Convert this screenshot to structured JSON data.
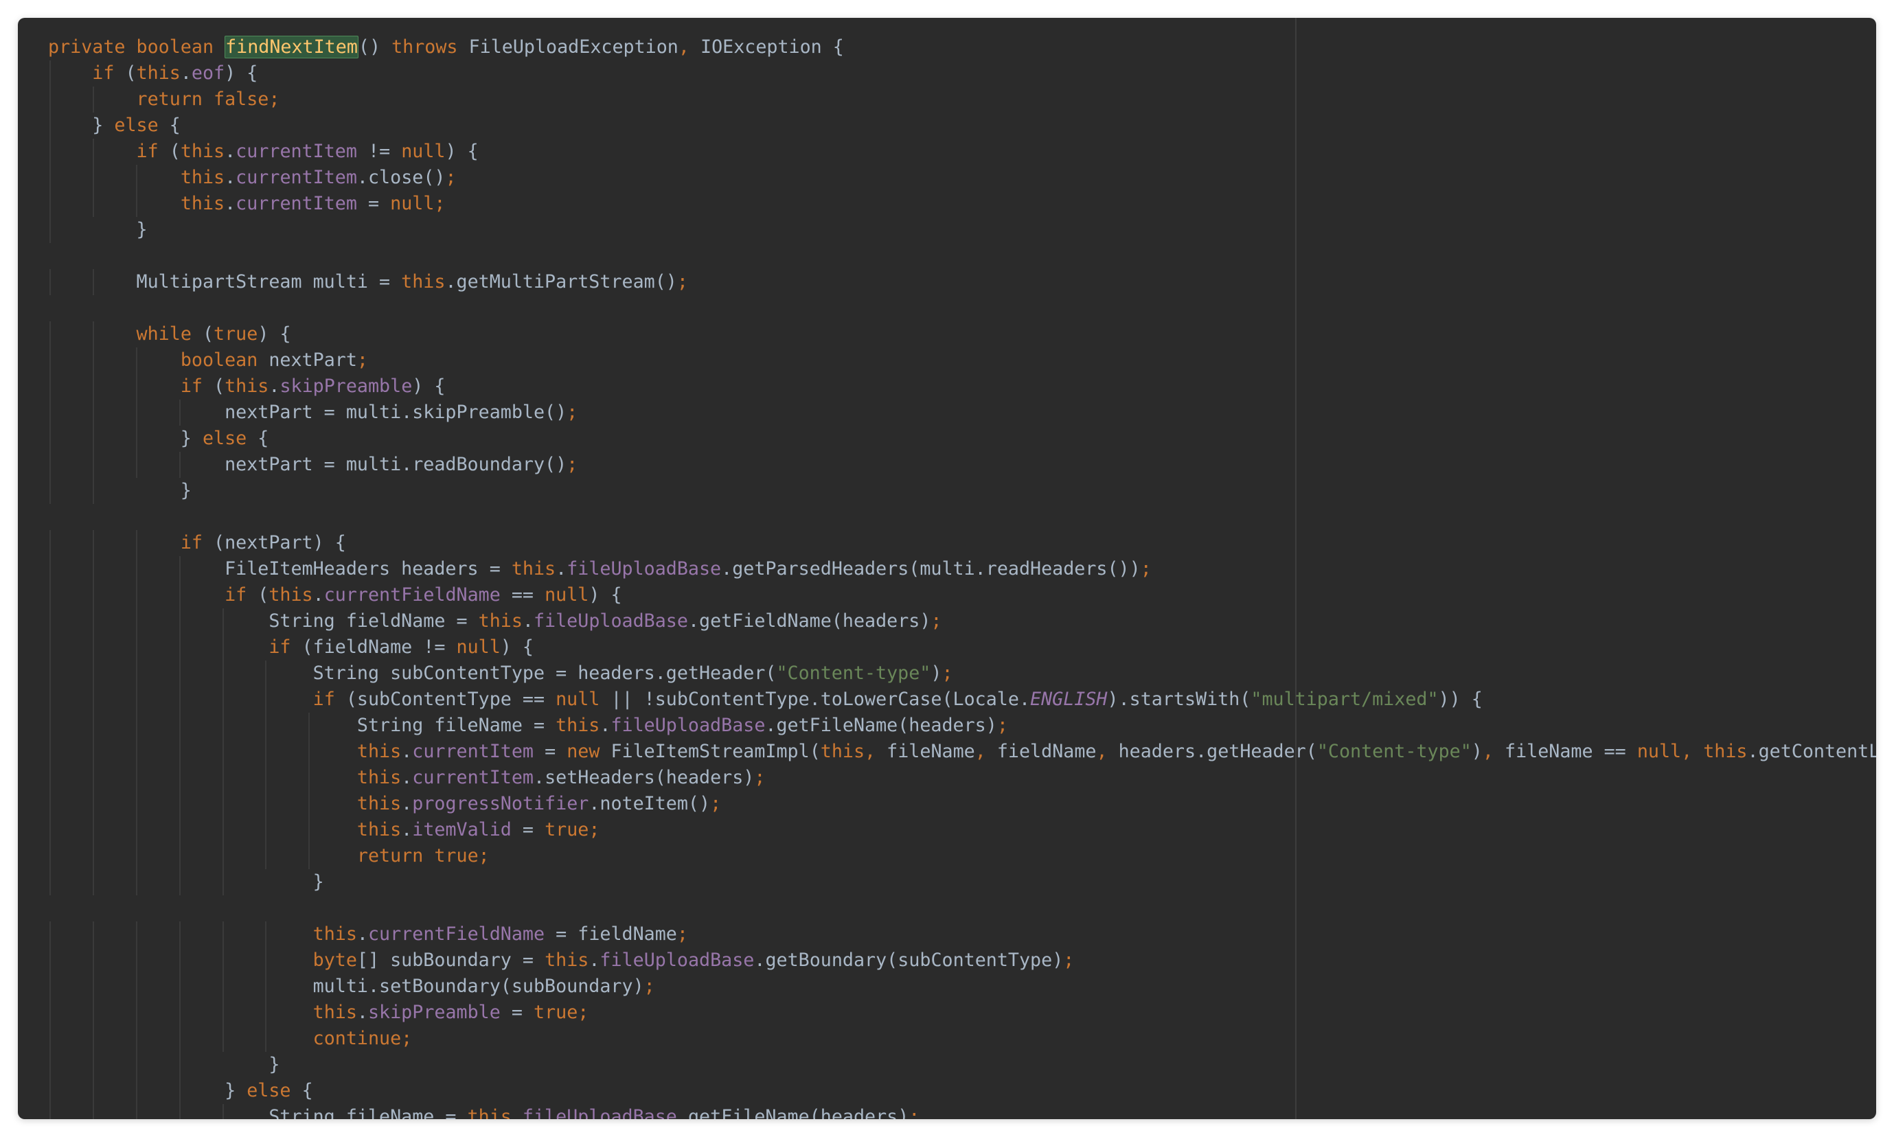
{
  "editor": {
    "theme_colors": {
      "background": "#2b2b2b",
      "keyword": "#cc7832",
      "field": "#9876aa",
      "string": "#6a8759",
      "plain": "#a9b7c6",
      "highlight": "#32593d"
    },
    "lines": [
      [
        [
          "kw",
          "private boolean "
        ],
        [
          "hl",
          "findNextItem"
        ],
        [
          "p",
          "() "
        ],
        [
          "kw",
          "throws "
        ],
        [
          "p",
          "FileUploadException"
        ],
        [
          "kw",
          ", "
        ],
        [
          "p",
          "IOException {"
        ]
      ],
      [
        [
          "p",
          "    "
        ],
        [
          "kw",
          "if "
        ],
        [
          "p",
          "("
        ],
        [
          "kw",
          "this"
        ],
        [
          "p",
          "."
        ],
        [
          "fld",
          "eof"
        ],
        [
          "p",
          ") {"
        ]
      ],
      [
        [
          "p",
          "        "
        ],
        [
          "kw",
          "return false;"
        ]
      ],
      [
        [
          "p",
          "    } "
        ],
        [
          "kw",
          "else "
        ],
        [
          "p",
          "{"
        ]
      ],
      [
        [
          "p",
          "        "
        ],
        [
          "kw",
          "if "
        ],
        [
          "p",
          "("
        ],
        [
          "kw",
          "this"
        ],
        [
          "p",
          "."
        ],
        [
          "fld",
          "currentItem"
        ],
        [
          "p",
          " != "
        ],
        [
          "kw",
          "null"
        ],
        [
          "p",
          ") {"
        ]
      ],
      [
        [
          "p",
          "            "
        ],
        [
          "kw",
          "this"
        ],
        [
          "p",
          "."
        ],
        [
          "fld",
          "currentItem"
        ],
        [
          "p",
          ".close()"
        ],
        [
          "kw",
          ";"
        ]
      ],
      [
        [
          "p",
          "            "
        ],
        [
          "kw",
          "this"
        ],
        [
          "p",
          "."
        ],
        [
          "fld",
          "currentItem"
        ],
        [
          "p",
          " = "
        ],
        [
          "kw",
          "null;"
        ]
      ],
      [
        [
          "p",
          "        }"
        ]
      ],
      [
        [
          "p",
          ""
        ]
      ],
      [
        [
          "p",
          "        MultipartStream multi = "
        ],
        [
          "kw",
          "this"
        ],
        [
          "p",
          ".getMultiPartStream()"
        ],
        [
          "kw",
          ";"
        ]
      ],
      [
        [
          "p",
          ""
        ]
      ],
      [
        [
          "p",
          "        "
        ],
        [
          "kw",
          "while "
        ],
        [
          "p",
          "("
        ],
        [
          "kw",
          "true"
        ],
        [
          "p",
          ") {"
        ]
      ],
      [
        [
          "p",
          "            "
        ],
        [
          "kw",
          "boolean "
        ],
        [
          "p",
          "nextPart"
        ],
        [
          "kw",
          ";"
        ]
      ],
      [
        [
          "p",
          "            "
        ],
        [
          "kw",
          "if "
        ],
        [
          "p",
          "("
        ],
        [
          "kw",
          "this"
        ],
        [
          "p",
          "."
        ],
        [
          "fld",
          "skipPreamble"
        ],
        [
          "p",
          ") {"
        ]
      ],
      [
        [
          "p",
          "                nextPart = multi.skipPreamble()"
        ],
        [
          "kw",
          ";"
        ]
      ],
      [
        [
          "p",
          "            } "
        ],
        [
          "kw",
          "else "
        ],
        [
          "p",
          "{"
        ]
      ],
      [
        [
          "p",
          "                nextPart = multi.readBoundary()"
        ],
        [
          "kw",
          ";"
        ]
      ],
      [
        [
          "p",
          "            }"
        ]
      ],
      [
        [
          "p",
          ""
        ]
      ],
      [
        [
          "p",
          "            "
        ],
        [
          "kw",
          "if "
        ],
        [
          "p",
          "(nextPart) {"
        ]
      ],
      [
        [
          "p",
          "                FileItemHeaders headers = "
        ],
        [
          "kw",
          "this"
        ],
        [
          "p",
          "."
        ],
        [
          "fld",
          "fileUploadBase"
        ],
        [
          "p",
          ".getParsedHeaders(multi.readHeaders())"
        ],
        [
          "kw",
          ";"
        ]
      ],
      [
        [
          "p",
          "                "
        ],
        [
          "kw",
          "if "
        ],
        [
          "p",
          "("
        ],
        [
          "kw",
          "this"
        ],
        [
          "p",
          "."
        ],
        [
          "fld",
          "currentFieldName"
        ],
        [
          "p",
          " == "
        ],
        [
          "kw",
          "null"
        ],
        [
          "p",
          ") {"
        ]
      ],
      [
        [
          "p",
          "                    String fieldName = "
        ],
        [
          "kw",
          "this"
        ],
        [
          "p",
          "."
        ],
        [
          "fld",
          "fileUploadBase"
        ],
        [
          "p",
          ".getFieldName(headers)"
        ],
        [
          "kw",
          ";"
        ]
      ],
      [
        [
          "p",
          "                    "
        ],
        [
          "kw",
          "if "
        ],
        [
          "p",
          "(fieldName != "
        ],
        [
          "kw",
          "null"
        ],
        [
          "p",
          ") {"
        ]
      ],
      [
        [
          "p",
          "                        String subContentType = headers.getHeader("
        ],
        [
          "str",
          "\"Content-type\""
        ],
        [
          "p",
          ")"
        ],
        [
          "kw",
          ";"
        ]
      ],
      [
        [
          "p",
          "                        "
        ],
        [
          "kw",
          "if "
        ],
        [
          "p",
          "(subContentType == "
        ],
        [
          "kw",
          "null "
        ],
        [
          "p",
          "|| !subContentType.toLowerCase(Locale."
        ],
        [
          "it",
          "ENGLISH"
        ],
        [
          "p",
          ").startsWith("
        ],
        [
          "str",
          "\"multipart/mixed\""
        ],
        [
          "p",
          ")) {"
        ]
      ],
      [
        [
          "p",
          "                            String fileName = "
        ],
        [
          "kw",
          "this"
        ],
        [
          "p",
          "."
        ],
        [
          "fld",
          "fileUploadBase"
        ],
        [
          "p",
          ".getFileName(headers)"
        ],
        [
          "kw",
          ";"
        ]
      ],
      [
        [
          "p",
          "                            "
        ],
        [
          "kw",
          "this"
        ],
        [
          "p",
          "."
        ],
        [
          "fld",
          "currentItem"
        ],
        [
          "p",
          " = "
        ],
        [
          "kw",
          "new "
        ],
        [
          "p",
          "FileItemStreamImpl("
        ],
        [
          "kw",
          "this, "
        ],
        [
          "p",
          "fileName"
        ],
        [
          "kw",
          ", "
        ],
        [
          "p",
          "fieldName"
        ],
        [
          "kw",
          ", "
        ],
        [
          "p",
          "headers.getHeader("
        ],
        [
          "str",
          "\"Content-type\""
        ],
        [
          "p",
          ")"
        ],
        [
          "kw",
          ", "
        ],
        [
          "p",
          "fileName == "
        ],
        [
          "kw",
          "null, this"
        ],
        [
          "p",
          ".getContentLengt"
        ]
      ],
      [
        [
          "p",
          "                            "
        ],
        [
          "kw",
          "this"
        ],
        [
          "p",
          "."
        ],
        [
          "fld",
          "currentItem"
        ],
        [
          "p",
          ".setHeaders(headers)"
        ],
        [
          "kw",
          ";"
        ]
      ],
      [
        [
          "p",
          "                            "
        ],
        [
          "kw",
          "this"
        ],
        [
          "p",
          "."
        ],
        [
          "fld",
          "progressNotifier"
        ],
        [
          "p",
          ".noteItem()"
        ],
        [
          "kw",
          ";"
        ]
      ],
      [
        [
          "p",
          "                            "
        ],
        [
          "kw",
          "this"
        ],
        [
          "p",
          "."
        ],
        [
          "fld",
          "itemValid"
        ],
        [
          "p",
          " = "
        ],
        [
          "kw",
          "true;"
        ]
      ],
      [
        [
          "p",
          "                            "
        ],
        [
          "kw",
          "return true;"
        ]
      ],
      [
        [
          "p",
          "                        }"
        ]
      ],
      [
        [
          "p",
          ""
        ]
      ],
      [
        [
          "p",
          "                        "
        ],
        [
          "kw",
          "this"
        ],
        [
          "p",
          "."
        ],
        [
          "fld",
          "currentFieldName"
        ],
        [
          "p",
          " = fieldName"
        ],
        [
          "kw",
          ";"
        ]
      ],
      [
        [
          "p",
          "                        "
        ],
        [
          "kw",
          "byte"
        ],
        [
          "p",
          "[] subBoundary = "
        ],
        [
          "kw",
          "this"
        ],
        [
          "p",
          "."
        ],
        [
          "fld",
          "fileUploadBase"
        ],
        [
          "p",
          ".getBoundary(subContentType)"
        ],
        [
          "kw",
          ";"
        ]
      ],
      [
        [
          "p",
          "                        multi.setBoundary(subBoundary)"
        ],
        [
          "kw",
          ";"
        ]
      ],
      [
        [
          "p",
          "                        "
        ],
        [
          "kw",
          "this"
        ],
        [
          "p",
          "."
        ],
        [
          "fld",
          "skipPreamble"
        ],
        [
          "p",
          " = "
        ],
        [
          "kw",
          "true;"
        ]
      ],
      [
        [
          "p",
          "                        "
        ],
        [
          "kw",
          "continue;"
        ]
      ],
      [
        [
          "p",
          "                    }"
        ]
      ],
      [
        [
          "p",
          "                } "
        ],
        [
          "kw",
          "else "
        ],
        [
          "p",
          "{"
        ]
      ],
      [
        [
          "p",
          "                    String fileName = "
        ],
        [
          "kw",
          "this"
        ],
        [
          "p",
          "."
        ],
        [
          "fld",
          "fileUploadBase"
        ],
        [
          "p",
          ".getFileName(headers)"
        ],
        [
          "kw",
          ";"
        ]
      ]
    ]
  }
}
